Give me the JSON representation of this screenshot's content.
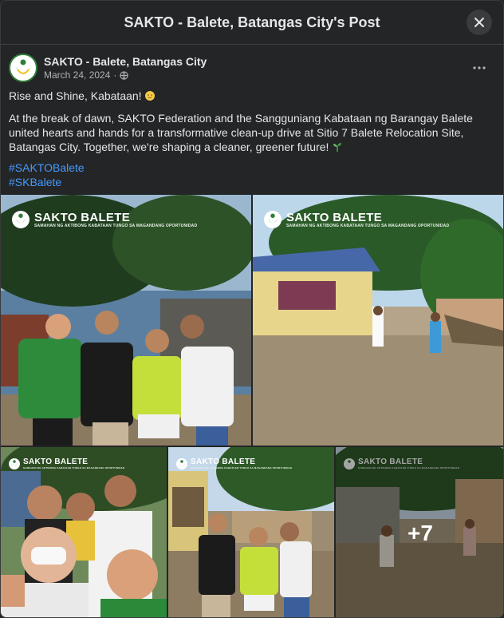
{
  "modal": {
    "title": "SAKTO - Balete, Batangas City's Post",
    "close_icon": "close-icon"
  },
  "post": {
    "page_name": "SAKTO - Balete, Batangas City",
    "date": "March 24, 2024",
    "audience_icon": "globe-icon",
    "more_icon": "more-options-icon",
    "line1": "Rise and Shine, Kabataan!",
    "line1_emoji": "sun-face-icon",
    "body": "At the break of dawn, SAKTO Federation and the Sangguniang Kabataan ng Barangay Balete united hearts and hands for a transformative clean-up drive at Sitio 7 Balete Relocation Site, Batangas City. Together, we're shaping a cleaner, greener future!",
    "body_emoji": "seedling-icon",
    "hashtags": [
      "#SAKTOBalete",
      "#SKBalete"
    ]
  },
  "photos": {
    "banner_title": "SAKTO BALETE",
    "banner_subtitle": "SAMAHAN NG AKTIBONG KABATAAN TUNGO SA MAGANDANG OPORTUNIDAD",
    "more_count": "+7"
  },
  "colors": {
    "background": "#242526",
    "text": "#e4e6eb",
    "secondary_text": "#b0b3b8",
    "hashtag": "#4599ff",
    "brand_green": "#2f7d3a"
  }
}
